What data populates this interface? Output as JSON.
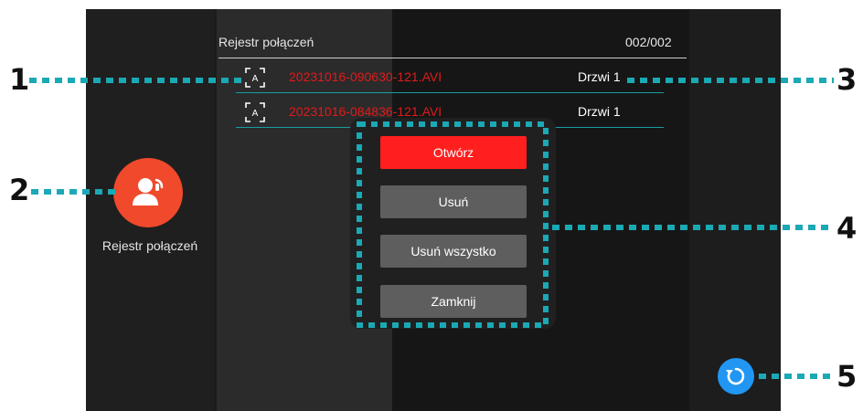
{
  "left_panel": {
    "call_log_label": "Rejestr połączeń",
    "call_log_icon": "person-phone-icon"
  },
  "list": {
    "title": "Rejestr połączeń",
    "count": "002/002",
    "rows": [
      {
        "filename": "20231016-090630-121.AVI",
        "source": "Drzwi 1",
        "icon": "video-file-icon"
      },
      {
        "filename": "20231016-084836-121.AVI",
        "source": "Drzwi 1",
        "icon": "video-file-icon"
      }
    ]
  },
  "dialog": {
    "open_label": "Otwórz",
    "delete_label": "Usuń",
    "delete_all_label": "Usuń wszystko",
    "close_label": "Zamknij"
  },
  "callouts": [
    "1",
    "2",
    "3",
    "4",
    "5"
  ],
  "colors": {
    "accent_red": "#ff1f1f",
    "filename_red": "#e01a1a",
    "call_orange": "#f0492c",
    "gray_button": "#5e5e5e",
    "teal_line": "#1a9ca0",
    "dotted_teal": "#1aa9b5",
    "refresh_blue": "#2196f3"
  }
}
